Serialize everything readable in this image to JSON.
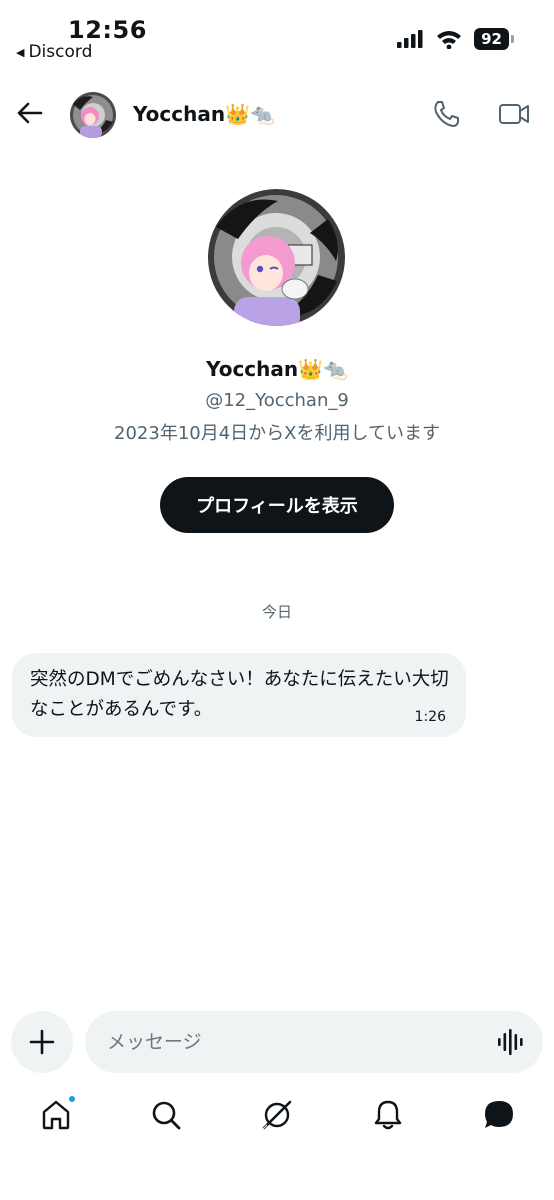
{
  "status_bar": {
    "time": "12:56",
    "back_app_label": "Discord",
    "back_app_icon": "back-triangle-icon",
    "battery": "92"
  },
  "header": {
    "name": "Yocchan👑🐀",
    "icons": [
      "back-arrow-icon",
      "phone-icon",
      "video-camera-icon"
    ]
  },
  "profile": {
    "name": "Yocchan👑🐀",
    "handle": "@12_Yocchan_9",
    "joined": "2023年10月4日からXを利用しています",
    "view_profile_label": "プロフィールを表示"
  },
  "conversation": {
    "date_separator": "今日",
    "messages": [
      {
        "text": "突然のDMでごめんなさい！あなたに伝えたい大切なことがあるんです。",
        "time": "1:26",
        "direction": "incoming"
      }
    ]
  },
  "composer": {
    "placeholder": "メッセージ",
    "value": "",
    "icons": [
      "plus-icon",
      "voice-icon"
    ]
  },
  "bottom_nav": {
    "items": [
      "home-icon",
      "search-icon",
      "grok-icon",
      "notifications-icon",
      "messages-icon"
    ],
    "active": "messages-icon",
    "badge_on": "home-icon"
  },
  "colors": {
    "text": "#0f1419",
    "secondary_text": "#536471",
    "bubble_bg": "#eff3f4",
    "button_bg": "#0f1419",
    "badge": "#1d9bf0"
  }
}
